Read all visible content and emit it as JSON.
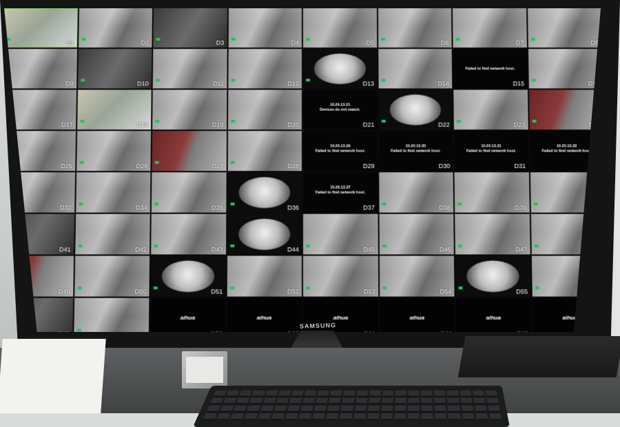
{
  "monitor": {
    "brand": "SAMSUNG"
  },
  "tiles": [
    {
      "kind": "cam",
      "chan": "D1",
      "ts": "",
      "cap": "",
      "selected": true,
      "tone": "color"
    },
    {
      "kind": "cam",
      "chan": "D2",
      "ts": "",
      "cap": "",
      "tone": "plain"
    },
    {
      "kind": "cam",
      "chan": "D3",
      "ts": "",
      "cap": "",
      "tone": "dark"
    },
    {
      "kind": "cam",
      "chan": "D4",
      "ts": "",
      "cap": "",
      "tone": "plain"
    },
    {
      "kind": "cam",
      "chan": "D5",
      "ts": "",
      "cap": "",
      "tone": "plain"
    },
    {
      "kind": "cam",
      "chan": "D6",
      "ts": "",
      "cap": "",
      "tone": "plain"
    },
    {
      "kind": "cam",
      "chan": "D7",
      "ts": "",
      "cap": "",
      "tone": "plain"
    },
    {
      "kind": "cam",
      "chan": "D8",
      "ts": "",
      "cap": "",
      "tone": "plain"
    },
    {
      "kind": "cam",
      "chan": "D9",
      "ts": "",
      "cap": "",
      "tone": "plain"
    },
    {
      "kind": "cam",
      "chan": "D10",
      "ts": "",
      "cap": "",
      "tone": "dark"
    },
    {
      "kind": "cam",
      "chan": "D11",
      "ts": "",
      "cap": "",
      "tone": "plain"
    },
    {
      "kind": "cam",
      "chan": "D12",
      "ts": "",
      "cap": "",
      "tone": "plain"
    },
    {
      "kind": "fisheye",
      "chan": "D13",
      "ts": "",
      "cap": ""
    },
    {
      "kind": "cam",
      "chan": "D14",
      "ts": "",
      "cap": "",
      "tone": "plain"
    },
    {
      "kind": "msg",
      "chan": "D15",
      "title": "",
      "body": "Failed to find network host."
    },
    {
      "kind": "cam",
      "chan": "D16",
      "ts": "",
      "cap": "",
      "tone": "plain"
    },
    {
      "kind": "cam",
      "chan": "D17",
      "ts": "",
      "cap": "",
      "tone": "plain"
    },
    {
      "kind": "cam",
      "chan": "D18",
      "ts": "",
      "cap": "",
      "tone": "color"
    },
    {
      "kind": "cam",
      "chan": "D19",
      "ts": "",
      "cap": "",
      "tone": "plain"
    },
    {
      "kind": "cam",
      "chan": "D20",
      "ts": "",
      "cap": "",
      "tone": "plain"
    },
    {
      "kind": "msg",
      "chan": "D21",
      "title": "10.20.13.21",
      "body": "Devices do not match."
    },
    {
      "kind": "fisheye",
      "chan": "D22",
      "ts": "",
      "cap": ""
    },
    {
      "kind": "cam",
      "chan": "D23",
      "ts": "",
      "cap": "",
      "tone": "plain"
    },
    {
      "kind": "cam",
      "chan": "D24",
      "ts": "",
      "cap": "",
      "tone": "red"
    },
    {
      "kind": "cam",
      "chan": "D25",
      "ts": "",
      "cap": "",
      "tone": "plain"
    },
    {
      "kind": "cam",
      "chan": "D26",
      "ts": "",
      "cap": "",
      "tone": "plain"
    },
    {
      "kind": "cam",
      "chan": "D27",
      "ts": "",
      "cap": "",
      "tone": "red"
    },
    {
      "kind": "cam",
      "chan": "D28",
      "ts": "",
      "cap": "",
      "tone": "plain"
    },
    {
      "kind": "msg",
      "chan": "D29",
      "title": "10.20.13.29",
      "body": "Failed to find network host."
    },
    {
      "kind": "msg",
      "chan": "D30",
      "title": "10.20.13.30",
      "body": "Failed to find network host."
    },
    {
      "kind": "msg",
      "chan": "D31",
      "title": "10.20.13.31",
      "body": "Failed to find network host."
    },
    {
      "kind": "msg",
      "chan": "D32",
      "title": "10.20.13.32",
      "body": "Failed to find network host."
    },
    {
      "kind": "cam",
      "chan": "D33",
      "ts": "",
      "cap": "",
      "tone": "plain"
    },
    {
      "kind": "cam",
      "chan": "D34",
      "ts": "",
      "cap": "",
      "tone": "plain"
    },
    {
      "kind": "cam",
      "chan": "D35",
      "ts": "",
      "cap": "",
      "tone": "plain"
    },
    {
      "kind": "fisheye",
      "chan": "D36",
      "ts": "",
      "cap": ""
    },
    {
      "kind": "msg",
      "chan": "D37",
      "title": "10.20.13.37",
      "body": "Failed to find network host."
    },
    {
      "kind": "cam",
      "chan": "D38",
      "ts": "",
      "cap": "",
      "tone": "plain"
    },
    {
      "kind": "cam",
      "chan": "D39",
      "ts": "",
      "cap": "",
      "tone": "plain"
    },
    {
      "kind": "cam",
      "chan": "D40",
      "ts": "",
      "cap": "",
      "tone": "plain"
    },
    {
      "kind": "cam",
      "chan": "D41",
      "ts": "",
      "cap": "",
      "tone": "dark"
    },
    {
      "kind": "cam",
      "chan": "D42",
      "ts": "",
      "cap": "",
      "tone": "plain"
    },
    {
      "kind": "cam",
      "chan": "D43",
      "ts": "",
      "cap": "",
      "tone": "plain"
    },
    {
      "kind": "fisheye",
      "chan": "D44",
      "ts": "",
      "cap": ""
    },
    {
      "kind": "cam",
      "chan": "D45",
      "ts": "",
      "cap": "",
      "tone": "plain"
    },
    {
      "kind": "cam",
      "chan": "D46",
      "ts": "",
      "cap": "",
      "tone": "plain"
    },
    {
      "kind": "cam",
      "chan": "D47",
      "ts": "",
      "cap": "",
      "tone": "plain"
    },
    {
      "kind": "cam",
      "chan": "D48",
      "ts": "",
      "cap": "",
      "tone": "plain"
    },
    {
      "kind": "cam",
      "chan": "D49",
      "ts": "",
      "cap": "",
      "tone": "red"
    },
    {
      "kind": "cam",
      "chan": "D50",
      "ts": "",
      "cap": "",
      "tone": "plain"
    },
    {
      "kind": "fisheye",
      "chan": "D51",
      "ts": "",
      "cap": ""
    },
    {
      "kind": "cam",
      "chan": "D52",
      "ts": "",
      "cap": "",
      "tone": "plain"
    },
    {
      "kind": "cam",
      "chan": "D53",
      "ts": "",
      "cap": "",
      "tone": "plain"
    },
    {
      "kind": "cam",
      "chan": "D54",
      "ts": "",
      "cap": "",
      "tone": "plain"
    },
    {
      "kind": "fisheye",
      "chan": "D55",
      "ts": "",
      "cap": ""
    },
    {
      "kind": "cam",
      "chan": "D56",
      "ts": "",
      "cap": "",
      "tone": "plain"
    },
    {
      "kind": "cam",
      "chan": "D57",
      "ts": "",
      "cap": "",
      "tone": "dark"
    },
    {
      "kind": "cam",
      "chan": "D58",
      "ts": "",
      "cap": "",
      "tone": "plain"
    },
    {
      "kind": "logo",
      "chan": "D59",
      "logo": "alhua"
    },
    {
      "kind": "logo",
      "chan": "D60",
      "logo": "alhua"
    },
    {
      "kind": "logo",
      "chan": "D61",
      "logo": "alhua"
    },
    {
      "kind": "logo",
      "chan": "D62",
      "logo": "alhua"
    },
    {
      "kind": "logo",
      "chan": "D63",
      "logo": "alhua"
    },
    {
      "kind": "logo",
      "chan": "D64",
      "logo": "alhua"
    }
  ],
  "colors": {
    "rec_indicator": "#22c25a",
    "selected_outline": "#7fd35a"
  }
}
